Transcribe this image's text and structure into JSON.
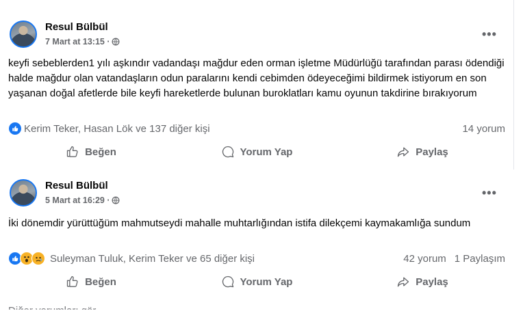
{
  "posts": [
    {
      "author": "Resul Bülbül",
      "date": "7 Mart at 13:15 ·",
      "text": "keyfi sebeblerden1 yılı aşkındır vadandaşı mağdur eden orman işletme Müdürlüğü tarafından parası ödendiği  halde  mağdur olan vatandaşların odun paralarını kendi cebimden ödeyeceğimi bildirmek istiyorum en son yaşanan doğal afetlerde bile keyfi hareketlerde bulunan buroklatları kamu oyunun takdirine bırakıyorum",
      "reactions_text": "Kerim Teker, Hasan Lök ve 137 diğer kişi",
      "comments": "14 yorum",
      "shares": "",
      "reaction_icons": [
        "like-icon"
      ]
    },
    {
      "author": "Resul Bülbül",
      "date": "5 Mart at 16:29 ·",
      "text": "İki dönemdir yürüttüğüm mahmutseydi mahalle muhtarlığından istifa dilekçemi kaymakamlığa sundum",
      "reactions_text": "Suleyman Tuluk, Kerim Teker ve 65 diğer kişi",
      "comments": "42 yorum",
      "shares": "1 Paylaşım",
      "reaction_icons": [
        "like-icon",
        "wow-icon",
        "sad-icon"
      ]
    }
  ],
  "actions": {
    "like": "Beğen",
    "comment": "Yorum Yap",
    "share": "Paylaş"
  },
  "more_label": "•••",
  "partial_text": "Diğer yorumları gör",
  "colors": {
    "brand": "#1877f2",
    "secondary_text": "#65676b"
  }
}
